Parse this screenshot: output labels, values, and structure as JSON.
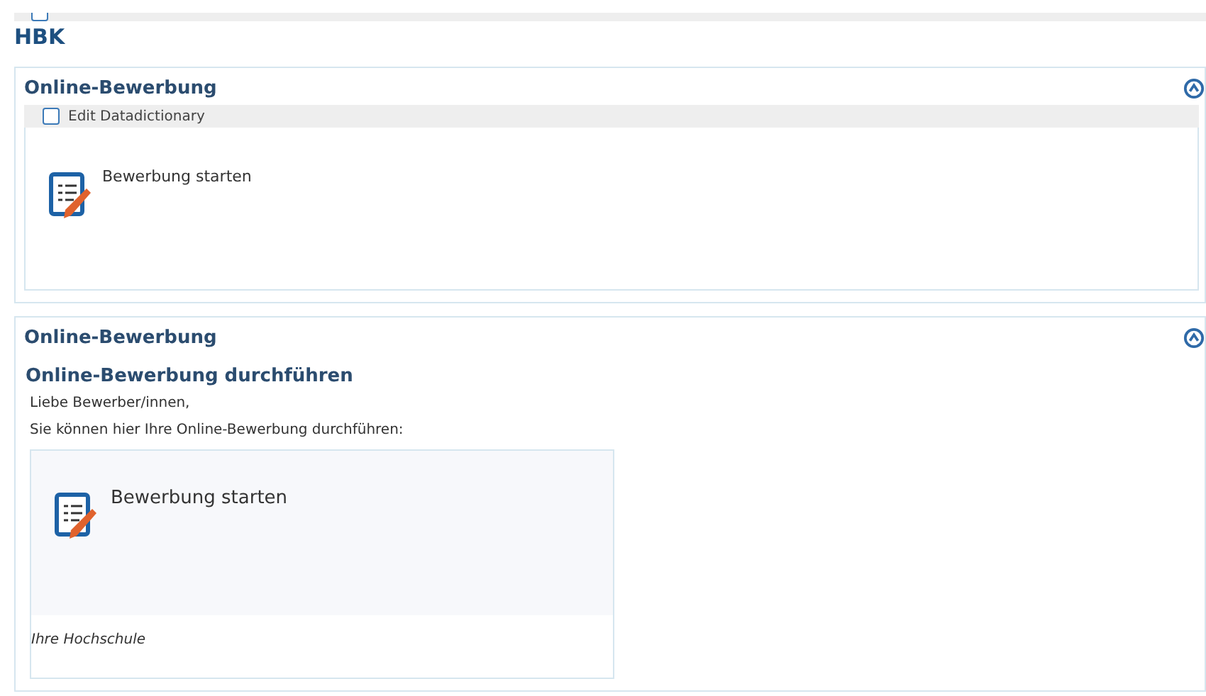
{
  "top_bar": {
    "checked": false
  },
  "title": "HBK",
  "panels": [
    {
      "kind": "edit",
      "heading": "Online-Bewerbung",
      "expanded": true,
      "edit_checkbox": {
        "label": "Edit Datadictionary",
        "checked": false
      },
      "link": "Bewerbung starten"
    },
    {
      "kind": "content",
      "heading": "Online-Bewerbung",
      "expanded": true,
      "subheading": "Online-Bewerbung durchführen",
      "paragraphs": [
        "Liebe Bewerber/innen,",
        "Sie können hier Ihre Online-Bewerbung durchführen:"
      ],
      "link": "Bewerbung starten",
      "footer": "Ihre Hochschule"
    }
  ]
}
